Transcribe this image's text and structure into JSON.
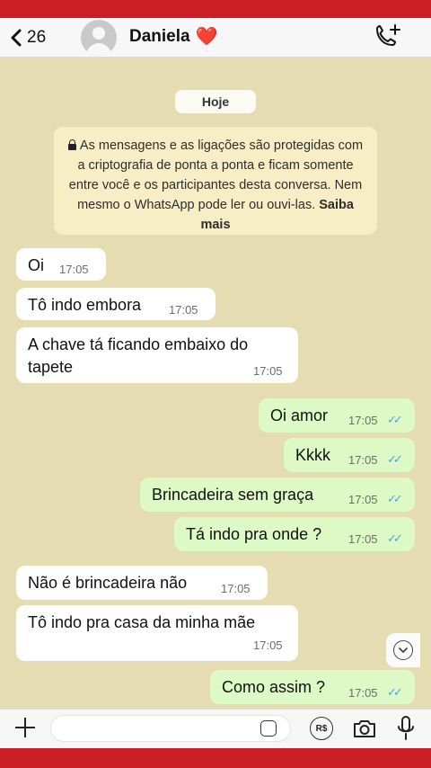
{
  "header": {
    "back_count": "26",
    "contact_name": "Daniela",
    "contact_emoji": "❤️"
  },
  "chat": {
    "date_chip": "Hoje",
    "encryption_notice": "As mensagens e as ligações são protegidas com a criptografia de ponta a ponta e ficam somente entre você e os participantes desta conversa. Nem mesmo o WhatsApp pode ler ou ouvi-las.",
    "encryption_link": "Saiba mais",
    "messages": [
      {
        "dir": "in",
        "text": "Oi",
        "time": "17:05"
      },
      {
        "dir": "in",
        "text": "Tô indo embora",
        "time": "17:05"
      },
      {
        "dir": "in",
        "text": "A chave tá ficando embaixo do",
        "text2": "tapete",
        "time": "17:05"
      },
      {
        "dir": "out",
        "text": "Oi amor",
        "time": "17:05",
        "ticks": "✓✓"
      },
      {
        "dir": "out",
        "text": "Kkkk",
        "time": "17:05",
        "ticks": "✓✓"
      },
      {
        "dir": "out",
        "text": "Brincadeira sem graça",
        "time": "17:05",
        "ticks": "✓✓"
      },
      {
        "dir": "out",
        "text": "Tá indo pra onde ?",
        "time": "17:05",
        "ticks": "✓✓"
      },
      {
        "dir": "in",
        "text": "Não é brincadeira não",
        "time": "17:05"
      },
      {
        "dir": "in",
        "text": "Tô indo pra casa da minha mãe",
        "time": "17:05"
      },
      {
        "dir": "out",
        "text": "Como assim ?",
        "time": "17:05",
        "ticks": "✓✓"
      }
    ]
  },
  "inputbar": {
    "pay_label": "R$"
  },
  "colors": {
    "chat_bg": "#e5ddb1",
    "outgoing_bubble": "#dcf9c6",
    "incoming_bubble": "#ffffff",
    "read_ticks": "#4fa6e8",
    "frame": "#cc1c24"
  }
}
